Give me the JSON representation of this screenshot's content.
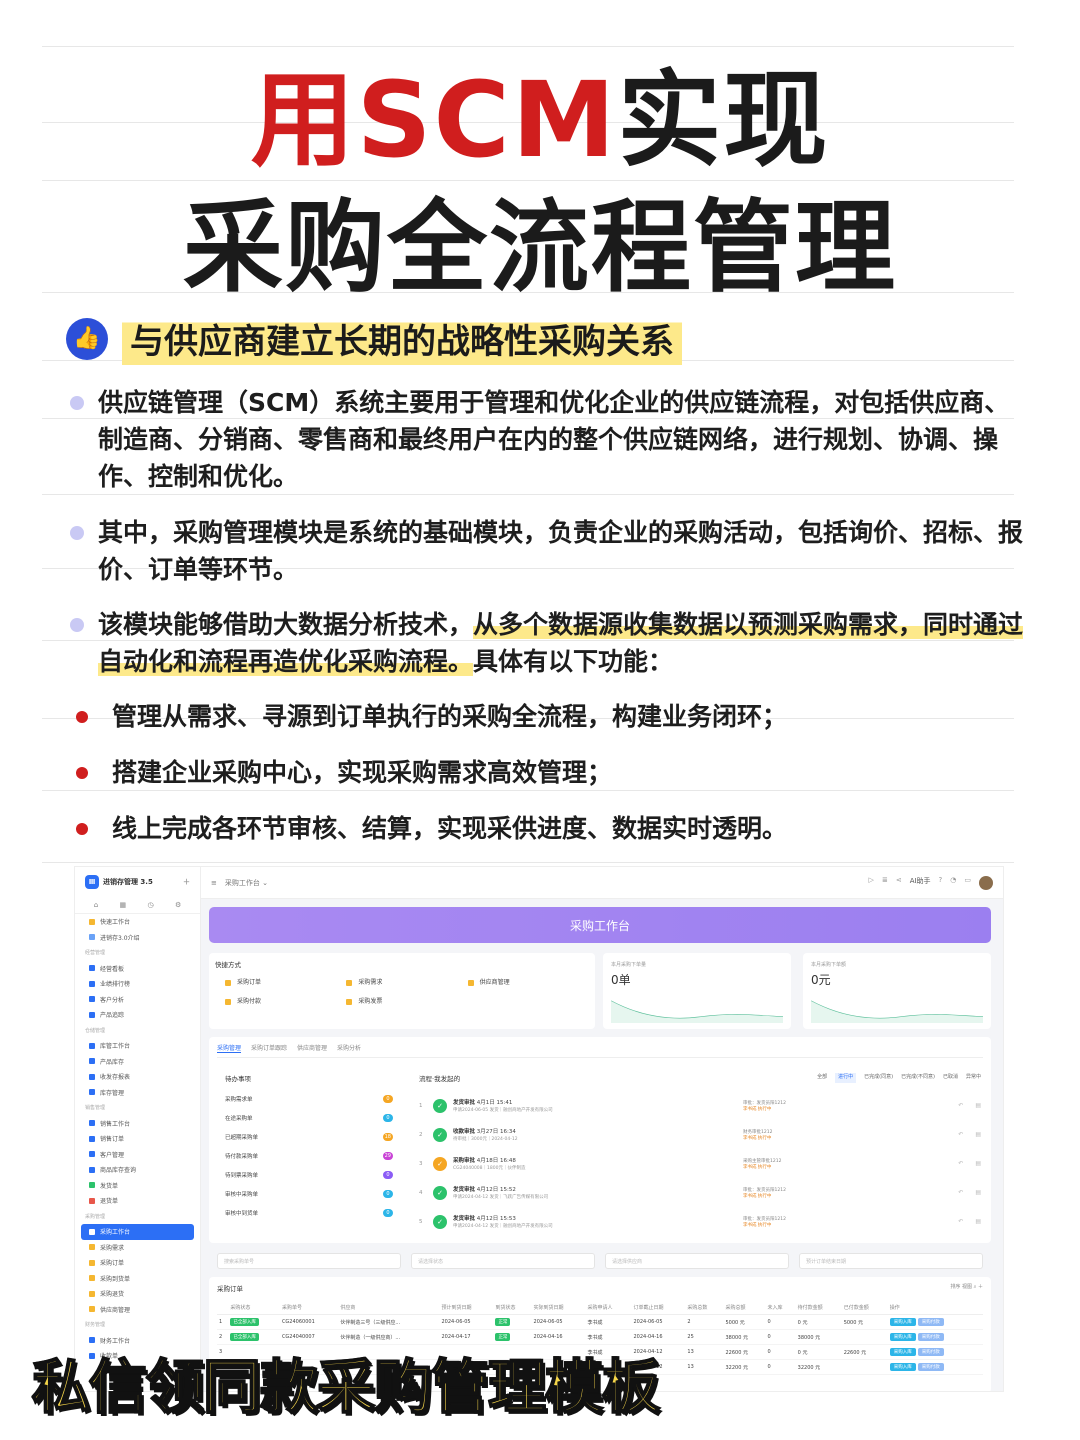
{
  "title": {
    "line1_red": "用SCM",
    "line1_black": "实现",
    "line2": "采购全流程管理"
  },
  "heading": "与供应商建立长期的战略性采购关系",
  "paragraphs": {
    "p1": "供应链管理（SCM）系统主要用于管理和优化企业的供应链流程，对包括供应商、制造商、分销商、零售商和最终用户在内的整个供应链网络，进行规划、协调、操作、控制和优化。",
    "p2": "其中，采购管理模块是系统的基础模块，负责企业的采购活动，包括询价、招标、报价、订单等环节。",
    "p3_a": "该模块能够借助大数据分析技术，",
    "p3_hl": "从多个数据源收集数据以预测采购需求，同时通过自动化和流程再造优化采购流程。",
    "p3_b": "具体有以下功能："
  },
  "bullets": [
    "管理从需求、寻源到订单执行的采购全流程，构建业务闭环；",
    "搭建企业采购中心，实现采购需求高效管理；",
    "线上完成各环节审核、结算，实现采供进度、数据实时透明。"
  ],
  "app": {
    "logo_text": "进销存管理 3.5",
    "logo_mark": "Ⅲ",
    "breadcrumb": "采购工作台 ⌄",
    "assistant": "AI助手",
    "sidebar": [
      {
        "label": "快速工作台",
        "type": "item",
        "color": "#f5b731"
      },
      {
        "label": "进销存3.0介绍",
        "type": "item",
        "color": "#6aa2f7"
      },
      {
        "label": "经营管理",
        "type": "group"
      },
      {
        "label": "经营看板",
        "type": "item",
        "color": "#2c6ff5"
      },
      {
        "label": "业绩排行榜",
        "type": "item",
        "color": "#2c6ff5"
      },
      {
        "label": "客户分析",
        "type": "item",
        "color": "#2c6ff5"
      },
      {
        "label": "产品追踪",
        "type": "item",
        "color": "#2c6ff5"
      },
      {
        "label": "仓储管理",
        "type": "group"
      },
      {
        "label": "库管工作台",
        "type": "item",
        "color": "#2c6ff5"
      },
      {
        "label": "产品库存",
        "type": "item",
        "color": "#2c6ff5"
      },
      {
        "label": "收发存报表",
        "type": "item",
        "color": "#2c6ff5"
      },
      {
        "label": "库存管理",
        "type": "item",
        "color": "#2c6ff5"
      },
      {
        "label": "销售管理",
        "type": "group"
      },
      {
        "label": "销售工作台",
        "type": "item",
        "color": "#2c6ff5"
      },
      {
        "label": "销售订单",
        "type": "item",
        "color": "#2c6ff5"
      },
      {
        "label": "客户管理",
        "type": "item",
        "color": "#2c6ff5"
      },
      {
        "label": "商品库存查询",
        "type": "item",
        "color": "#2c6ff5"
      },
      {
        "label": "发货单",
        "type": "item",
        "color": "#2cc26b"
      },
      {
        "label": "退货单",
        "type": "item",
        "color": "#e8574a"
      },
      {
        "label": "采购管理",
        "type": "group"
      },
      {
        "label": "采购工作台",
        "type": "active",
        "color": "#ffffff"
      },
      {
        "label": "采购需求",
        "type": "item",
        "color": "#f5b731"
      },
      {
        "label": "采购订单",
        "type": "item",
        "color": "#f5b731"
      },
      {
        "label": "采购到货单",
        "type": "item",
        "color": "#f5b731"
      },
      {
        "label": "采购退货",
        "type": "item",
        "color": "#f5b731"
      },
      {
        "label": "供应商管理",
        "type": "item",
        "color": "#f5b731"
      },
      {
        "label": "财务管理",
        "type": "group"
      },
      {
        "label": "财务工作台",
        "type": "item",
        "color": "#2c6ff5"
      },
      {
        "label": "收款单",
        "type": "item",
        "color": "#2c6ff5"
      }
    ],
    "banner": "采购工作台",
    "quick": {
      "title": "快捷方式",
      "items": [
        {
          "label": "采购订单",
          "color": "#f5b731"
        },
        {
          "label": "采购需求",
          "color": "#f5b731"
        },
        {
          "label": "供应商管理",
          "color": "#f5b731"
        },
        {
          "label": "采购付款",
          "color": "#f5b731"
        },
        {
          "label": "采购发票",
          "color": "#f5b731"
        }
      ]
    },
    "stats": [
      {
        "label": "本月采购下单量",
        "value": "0单"
      },
      {
        "label": "本月采购下单额",
        "value": "0元"
      }
    ],
    "tabs": [
      "采购管理",
      "采购订单跟踪",
      "供应商管理",
      "采购分析"
    ],
    "todo": {
      "title": "待办事项",
      "items": [
        {
          "label": "采购需求单",
          "count": "0",
          "color": "#f5a623"
        },
        {
          "label": "在途采购单",
          "count": "0",
          "color": "#2cb5e8"
        },
        {
          "label": "已超期采购单",
          "count": "18",
          "color": "#f5a623"
        },
        {
          "label": "待付款采购单",
          "count": "29",
          "color": "#c944d6"
        },
        {
          "label": "待到票采购单",
          "count": "0",
          "color": "#8b5cf6"
        },
        {
          "label": "审核中采购单",
          "count": "0",
          "color": "#2cb5e8"
        },
        {
          "label": "审核中到货单",
          "count": "0",
          "color": "#2cb5e8"
        }
      ]
    },
    "flow": {
      "title": "流程·我发起的",
      "options": [
        "全部",
        "进行中",
        "已完成(同意)",
        "已完成(不同意)",
        "已取消",
        "异常中"
      ],
      "rows": [
        {
          "n": "1",
          "name": "发货审批",
          "time": "4月1日 15:41",
          "desc": "申请2024-06-05 发货｜融创商地产开发有限公司",
          "who": "审批：发货员阳1212",
          "status": "李书成 执行中",
          "color": "#2cc26b"
        },
        {
          "n": "2",
          "name": "收款审批",
          "time": "3月27日 16:34",
          "desc": "待审批｜3000元｜2024-04-12",
          "who": "财务审批1212",
          "status": "李书成 执行中",
          "color": "#2cc26b"
        },
        {
          "n": "3",
          "name": "采购审批",
          "time": "4月18日 16:48",
          "desc": "CG24040008｜1800元｜伙伴制造",
          "who": "采购主管审批1212",
          "status": "李书成 执行中",
          "color": "#f5a623"
        },
        {
          "n": "4",
          "name": "发货审批",
          "time": "4月12日 15:52",
          "desc": "申请2024-04-12 发货｜飞跃广告传媒有限公司",
          "who": "审批：发货员阳1212",
          "status": "李书成 执行中",
          "color": "#2cc26b"
        },
        {
          "n": "5",
          "name": "发货审批",
          "time": "4月12日 15:53",
          "desc": "申请2024-04-12 发货｜融创商地产开发有限公司",
          "who": "审批：发货员阳1212",
          "status": "李书成 执行中",
          "color": "#2cc26b"
        }
      ]
    },
    "filters": [
      "搜索采购单号",
      "请选择状态",
      "请选择供应商",
      "预计订单结束日期"
    ],
    "order": {
      "title": "采购订单",
      "tools": "排序 视图 ⌕ ＋",
      "headers": [
        "",
        "采购状态",
        "采购单号",
        "供应商",
        "预计到货日期",
        "到货状态",
        "实际到货日期",
        "采购申请人",
        "订单截止日期",
        "采购总数",
        "采购总额",
        "未入库",
        "待付款金额",
        "已付款金额",
        "操作"
      ],
      "rows": [
        [
          "1",
          "已全部入库",
          "CG24060001",
          "伙伴制造三号（三级供应...",
          "2024-06-05",
          "正常",
          "2024-06-05",
          "李书成",
          "2024-06-05",
          "2",
          "5000 元",
          "0",
          "0 元",
          "5000 元",
          ""
        ],
        [
          "2",
          "已全部入库",
          "CG24040007",
          "伙伴制造（一级供应商）...",
          "2024-04-17",
          "正常",
          "2024-04-16",
          "李书成",
          "2024-04-16",
          "25",
          "38000 元",
          "0",
          "38000 元",
          "",
          ""
        ],
        [
          "3",
          "",
          "",
          "",
          "",
          "",
          "",
          "李书成",
          "2024-04-12",
          "13",
          "22600 元",
          "0",
          "0 元",
          "22600 元",
          ""
        ],
        [
          "4",
          "",
          "",
          "",
          "",
          "",
          "",
          "李书成",
          "2024-04-12",
          "13",
          "32200 元",
          "0",
          "32200 元",
          "",
          ""
        ]
      ],
      "btn_in": "采购入库",
      "btn_pay": "采购付款"
    }
  },
  "footer": "私信领同款采购管理模板",
  "colors": {
    "red": "#d01e1e",
    "accent": "#2c6ff5",
    "highlight": "#fde98a",
    "banner": "#a98af2"
  }
}
